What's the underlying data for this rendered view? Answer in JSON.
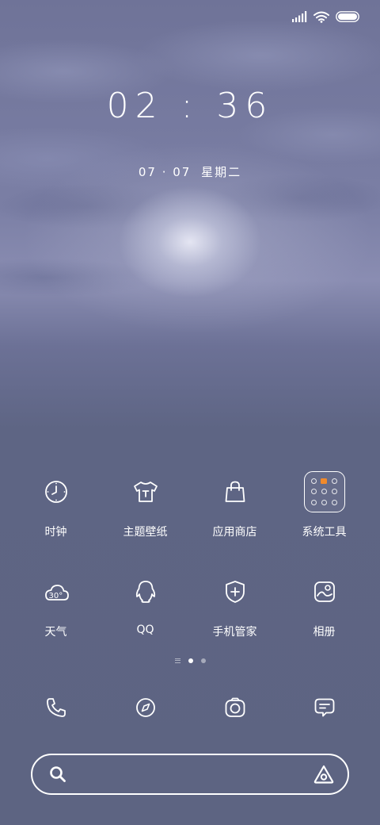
{
  "status_bar": {
    "signal_icon": "signal-bars-icon",
    "wifi_icon": "wifi-icon",
    "battery_icon": "battery-icon"
  },
  "clock": {
    "time": "02 : 36",
    "date": "07 · 07",
    "weekday": "星期二"
  },
  "apps": {
    "row1": [
      {
        "label": "时钟",
        "icon": "clock-icon"
      },
      {
        "label": "主题壁纸",
        "icon": "tshirt-icon"
      },
      {
        "label": "应用商店",
        "icon": "shopping-bag-icon"
      },
      {
        "label": "系统工具",
        "icon": "folder-icon"
      }
    ],
    "row2": [
      {
        "label": "天气",
        "icon": "weather-icon",
        "temp": "30°"
      },
      {
        "label": "QQ",
        "icon": "qq-penguin-icon"
      },
      {
        "label": "手机管家",
        "icon": "shield-plus-icon"
      },
      {
        "label": "相册",
        "icon": "gallery-icon"
      }
    ]
  },
  "page_indicator": {
    "pages": 2,
    "current": 1
  },
  "dock": [
    {
      "icon": "phone-icon"
    },
    {
      "icon": "browser-compass-icon"
    },
    {
      "icon": "camera-icon"
    },
    {
      "icon": "message-icon"
    }
  ],
  "search": {
    "left_icon": "search-icon",
    "right_icon": "assistant-icon"
  },
  "colors": {
    "background": "#5d6482",
    "accent_orange": "#f08a2c",
    "foreground": "#ffffff"
  }
}
